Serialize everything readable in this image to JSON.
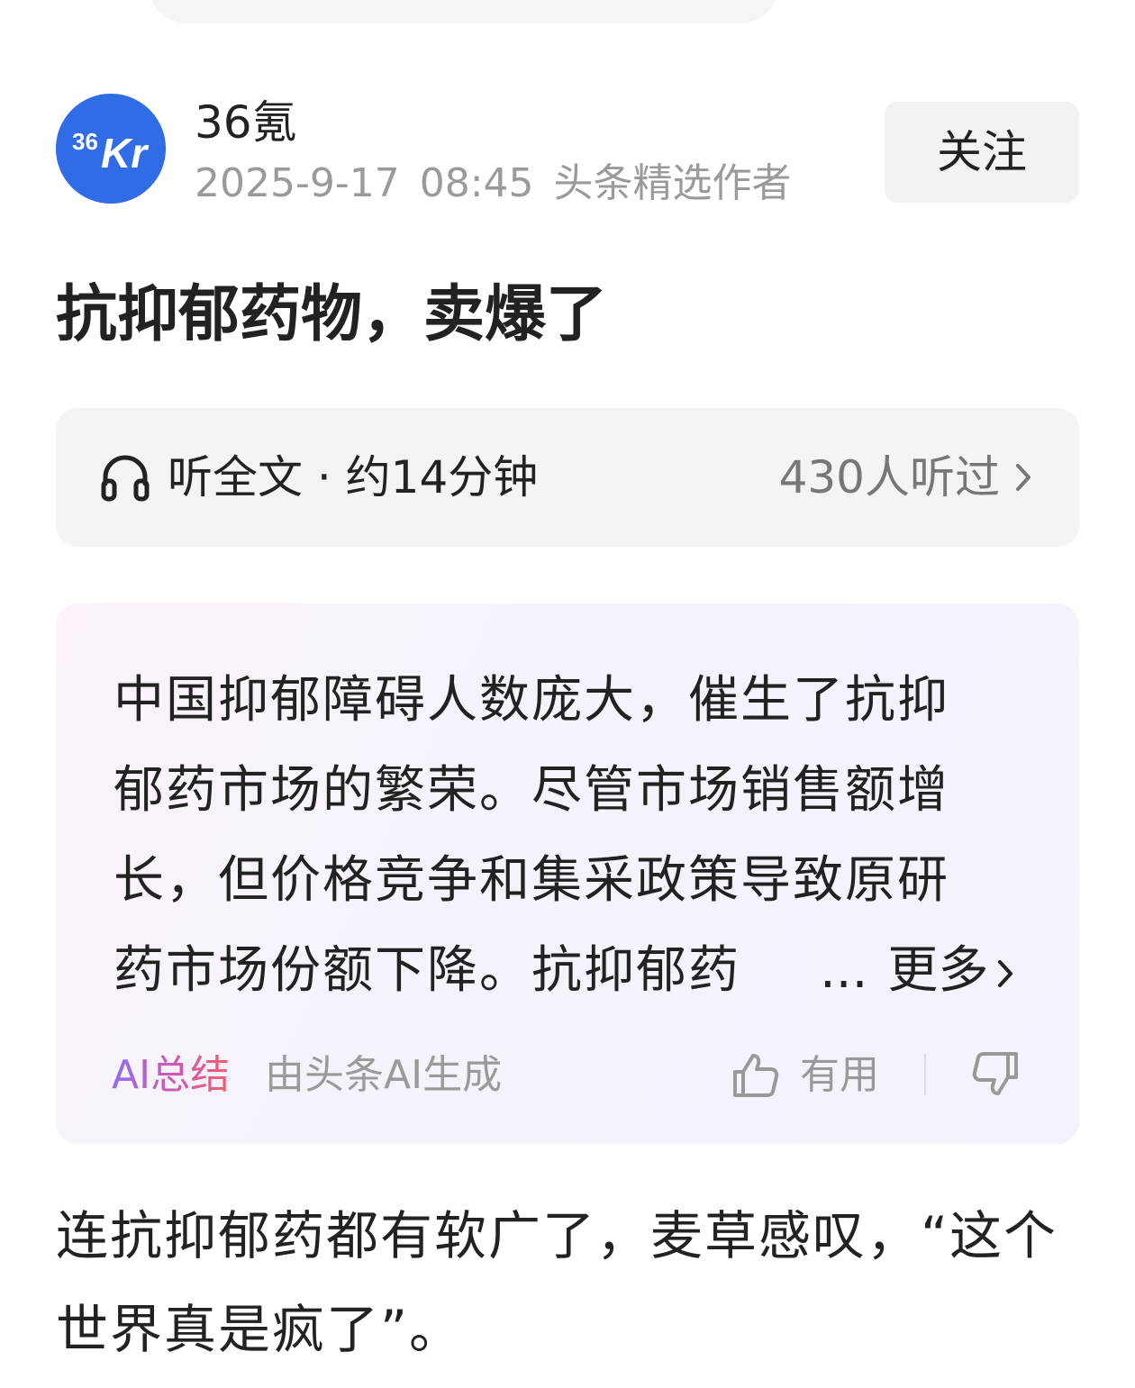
{
  "author": {
    "name": "36氪",
    "date": "2025-9-17",
    "time": "08:45",
    "badge": "头条精选作者",
    "avatar_text": "36Kr",
    "avatar_color": "#2f6ce5"
  },
  "follow_button": {
    "label": "关注"
  },
  "article": {
    "title": "抗抑郁药物，卖爆了",
    "body_lines": [
      "连抗抑郁药都有软广了，麦草感叹，“这个",
      "世界真是疯了”。"
    ]
  },
  "listen": {
    "icon": "headphone-icon",
    "label": "听全文 · 约14分钟",
    "count": "430人听过"
  },
  "summary": {
    "lines": [
      "中国抑郁障碍人数庞大，催生了抗抑",
      "郁药市场的繁荣。尽管市场销售额增",
      "长，但价格竞争和集采政策导致原研",
      "药市场份额下降。抗抑郁药"
    ],
    "ellipsis": "...",
    "more_label": "更多",
    "ai_tag": "AI总结",
    "source": "由头条AI生成",
    "useful_label": "有用"
  }
}
